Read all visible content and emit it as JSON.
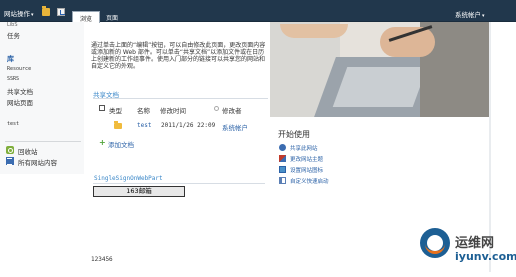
{
  "ribbon": {
    "site_actions": "网站操作",
    "tabs": [
      "浏览",
      "页面"
    ],
    "user": "系统帐户"
  },
  "leftnav": {
    "cut_item": "LibS",
    "tasks": "任务",
    "library_heading": "库",
    "items": [
      "Resource",
      "SSRS",
      "共享文档",
      "网站页面"
    ],
    "test": "test",
    "recycle_bin": "回收站",
    "all_site_content": "所有网站内容"
  },
  "intro": {
    "text": "通过单击上面的“编辑”按钮，可以自由修改此页面，更改页面内容或添加新的 Web 部件。可以单击“共享文档”以添加文件或在日历上创建新的工作组事件。使用入门部分的链接可以共享您的网站和自定义它的外观。"
  },
  "documents": {
    "title": "共享文档",
    "columns": [
      "类型",
      "名称",
      "修改时间",
      "修改者"
    ],
    "rows": [
      {
        "name": "test",
        "modified": "2011/1/26 22:09",
        "modified_by": "系统帐户"
      }
    ],
    "add_link": "添加文档"
  },
  "sso": {
    "title": "SingleSignOnWebPart",
    "button": "163邮箱"
  },
  "footer_text": "123456",
  "getting_started": {
    "title": "开始使用",
    "items": [
      {
        "label": "共享此网站",
        "icon": "share-icon",
        "color": "#3b6cb0"
      },
      {
        "label": "更改网站主题",
        "icon": "theme-icon",
        "color": "#c23a2b"
      },
      {
        "label": "设置网站图标",
        "icon": "picture-icon",
        "color": "#4a90c8"
      },
      {
        "label": "自定义快速启动",
        "icon": "quicklaunch-icon",
        "color": "#5b7fb5"
      }
    ]
  },
  "watermark": {
    "cn": "运维网",
    "url": "iyunv.com"
  },
  "colors": {
    "ribbon": "#21374c",
    "link": "#2b62a7",
    "section_title": "#3a87c8"
  }
}
